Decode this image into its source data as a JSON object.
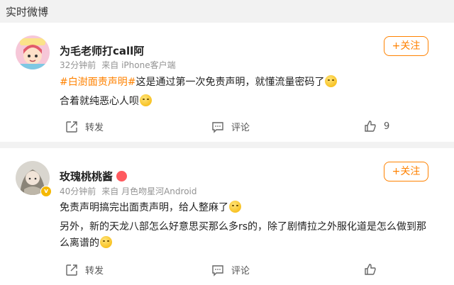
{
  "section": {
    "title": "实时微博"
  },
  "posts": [
    {
      "username": "为毛老师打call阿",
      "time": "32分钟前",
      "source": "来自 iPhone客户端",
      "follow_label": "+关注",
      "hashtag": "#白澍面责声明#",
      "line1": "这是通过第一次免责声明，就懂流量密码了",
      "line2": "合着就纯恶心人呗",
      "share_label": "转发",
      "comment_label": "评论",
      "like_count": "9"
    },
    {
      "username": "玫瑰桃桃酱",
      "time": "40分钟前",
      "source": "来自 月色吻星河Android",
      "follow_label": "+关注",
      "line1": "免责声明搞完出面责声明，给人整麻了",
      "line2": "另外，新的天龙八部怎么好意思买那么多rs的，除了剧情拉之外服化道是怎么做到那",
      "line3": "么离谱的",
      "share_label": "转发",
      "comment_label": "评论"
    }
  ]
}
